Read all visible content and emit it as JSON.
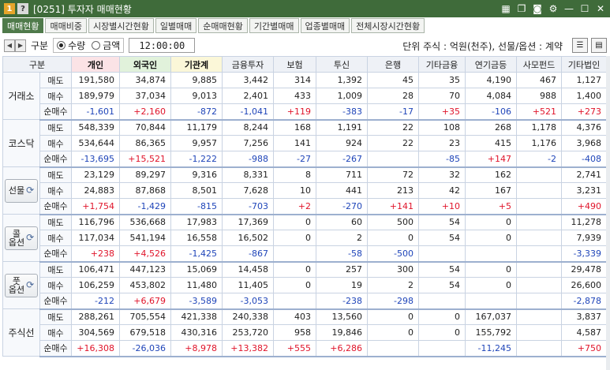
{
  "window": {
    "badge1": "1",
    "badge2": "?",
    "title": "[0251] 투자자 매매현황"
  },
  "tabs": [
    "매매현황",
    "매매비중",
    "시장별시간현황",
    "일별매매",
    "순매매현황",
    "기간별매매",
    "업종별매매",
    "전체시장시간현황"
  ],
  "toolbar": {
    "gubun": "구분",
    "radio_qty": "수량",
    "radio_amt": "금액",
    "time": "12:00:00",
    "unit": "단위 주식 : 억원(천주), 선물/옵션 : 계약"
  },
  "columns": [
    "구분",
    "개인",
    "외국인",
    "기관계",
    "금융투자",
    "보험",
    "투신",
    "은행",
    "기타금융",
    "연기금등",
    "사모펀드",
    "기타법인"
  ],
  "groups": [
    {
      "label": "거래소",
      "button": false,
      "rows": [
        {
          "sub": "매도",
          "v": [
            "191,580",
            "34,874",
            "9,885",
            "3,442",
            "314",
            "1,392",
            "45",
            "35",
            "4,190",
            "467",
            "1,127"
          ]
        },
        {
          "sub": "매수",
          "v": [
            "189,979",
            "37,034",
            "9,013",
            "2,401",
            "433",
            "1,009",
            "28",
            "70",
            "4,084",
            "988",
            "1,400"
          ]
        },
        {
          "sub": "순매수",
          "v": [
            "-1,601",
            "+2,160",
            "-872",
            "-1,041",
            "+119",
            "-383",
            "-17",
            "+35",
            "-106",
            "+521",
            "+273"
          ]
        }
      ]
    },
    {
      "label": "코스닥",
      "button": false,
      "rows": [
        {
          "sub": "매도",
          "v": [
            "548,339",
            "70,844",
            "11,179",
            "8,244",
            "168",
            "1,191",
            "22",
            "108",
            "268",
            "1,178",
            "4,376"
          ]
        },
        {
          "sub": "매수",
          "v": [
            "534,644",
            "86,365",
            "9,957",
            "7,256",
            "141",
            "924",
            "22",
            "23",
            "415",
            "1,176",
            "3,968"
          ]
        },
        {
          "sub": "순매수",
          "v": [
            "-13,695",
            "+15,521",
            "-1,222",
            "-988",
            "-27",
            "-267",
            "",
            "-85",
            "+147",
            "-2",
            "-408"
          ]
        }
      ]
    },
    {
      "label": "선물",
      "button": true,
      "rows": [
        {
          "sub": "매도",
          "v": [
            "23,129",
            "89,297",
            "9,316",
            "8,331",
            "8",
            "711",
            "72",
            "32",
            "162",
            "",
            "2,741"
          ]
        },
        {
          "sub": "매수",
          "v": [
            "24,883",
            "87,868",
            "8,501",
            "7,628",
            "10",
            "441",
            "213",
            "42",
            "167",
            "",
            "3,231"
          ]
        },
        {
          "sub": "순매수",
          "v": [
            "+1,754",
            "-1,429",
            "-815",
            "-703",
            "+2",
            "-270",
            "+141",
            "+10",
            "+5",
            "",
            "+490"
          ]
        }
      ]
    },
    {
      "label": "콜\n옵션",
      "button": true,
      "rows": [
        {
          "sub": "매도",
          "v": [
            "116,796",
            "536,668",
            "17,983",
            "17,369",
            "0",
            "60",
            "500",
            "54",
            "0",
            "",
            "11,278"
          ]
        },
        {
          "sub": "매수",
          "v": [
            "117,034",
            "541,194",
            "16,558",
            "16,502",
            "0",
            "2",
            "0",
            "54",
            "0",
            "",
            "7,939"
          ]
        },
        {
          "sub": "순매수",
          "v": [
            "+238",
            "+4,526",
            "-1,425",
            "-867",
            "",
            "-58",
            "-500",
            "",
            "",
            "",
            "-3,339"
          ]
        }
      ]
    },
    {
      "label": "풋\n옵션",
      "button": true,
      "rows": [
        {
          "sub": "매도",
          "v": [
            "106,471",
            "447,123",
            "15,069",
            "14,458",
            "0",
            "257",
            "300",
            "54",
            "0",
            "",
            "29,478"
          ]
        },
        {
          "sub": "매수",
          "v": [
            "106,259",
            "453,802",
            "11,480",
            "11,405",
            "0",
            "19",
            "2",
            "54",
            "0",
            "",
            "26,600"
          ]
        },
        {
          "sub": "순매수",
          "v": [
            "-212",
            "+6,679",
            "-3,589",
            "-3,053",
            "",
            "-238",
            "-298",
            "",
            "",
            "",
            "-2,878"
          ]
        }
      ]
    },
    {
      "label": "주식선",
      "button": false,
      "rows": [
        {
          "sub": "매도",
          "v": [
            "288,261",
            "705,554",
            "421,338",
            "240,338",
            "403",
            "13,560",
            "0",
            "0",
            "167,037",
            "",
            "3,837"
          ]
        },
        {
          "sub": "매수",
          "v": [
            "304,569",
            "679,518",
            "430,316",
            "253,720",
            "958",
            "19,846",
            "0",
            "0",
            "155,792",
            "",
            "4,587"
          ]
        },
        {
          "sub": "순매수",
          "v": [
            "+16,308",
            "-26,036",
            "+8,978",
            "+13,382",
            "+555",
            "+6,286",
            "",
            "",
            "-11,245",
            "",
            "+750"
          ]
        }
      ]
    }
  ],
  "colors": {
    "title_bg": "#3f6b3a",
    "tab_active": "#4f7a4a",
    "positive": "#e0142a",
    "negative": "#1f45b9"
  }
}
